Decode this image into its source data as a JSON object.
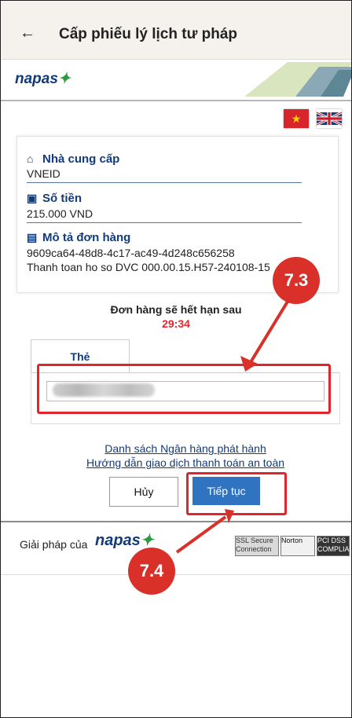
{
  "appbar": {
    "back_icon": "arrow-left-icon",
    "title": "Cấp phiếu lý lịch tư pháp"
  },
  "brand": {
    "name": "napas",
    "star_icon": "napas-star-icon"
  },
  "languages": [
    "vietnam-flag",
    "uk-flag"
  ],
  "info": {
    "provider_label": "Nhà cung cấp",
    "provider_value": "VNEID",
    "amount_label": "Số tiền",
    "amount_value": "215.000 VND",
    "order_label": "Mô tả đơn hàng",
    "order_id": "9609ca64-48d8-4c17-ac49-4d248c656258",
    "order_desc": "Thanh toan ho so DVC 000.00.15.H57-240108-15"
  },
  "expiry": {
    "label": "Đơn hàng sẽ hết hạn sau",
    "timer": "29:34"
  },
  "card": {
    "tab_label": "Thẻ"
  },
  "links": {
    "issuers": "Danh sách Ngân hàng phát hành",
    "guide": "Hướng dẫn giao dịch thanh toán an toàn"
  },
  "actions": {
    "cancel": "Hủy",
    "continue": "Tiếp tục"
  },
  "footer": {
    "solution_text": "Giải pháp của",
    "brand": "napas",
    "ssl_badge": "SSL Secure Connection",
    "norton_badge": "Norton",
    "pci_badge": "PCI DSS COMPLIANT"
  },
  "annotations": {
    "step_73": "7.3",
    "step_74": "7.4"
  },
  "colors": {
    "accent_blue": "#123b7a",
    "button_blue": "#2f73c1",
    "highlight_red": "#e0262c",
    "callout_red": "#d9312a",
    "timer_red": "#e0282e"
  }
}
